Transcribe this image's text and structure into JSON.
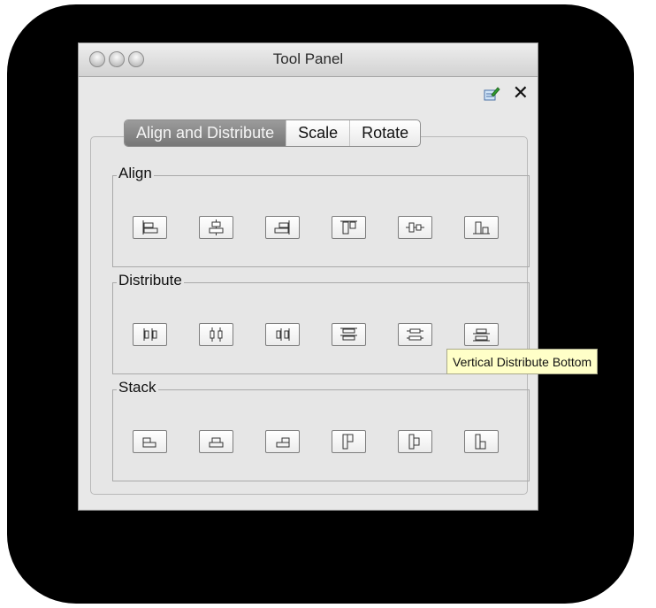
{
  "window": {
    "title": "Tool Panel"
  },
  "toolbar": {
    "edit_icon": "edit-pencil-icon",
    "close_icon": "close-icon",
    "close_glyph": "✕"
  },
  "tabs": [
    {
      "label": "Align and Distribute",
      "selected": true
    },
    {
      "label": "Scale",
      "selected": false
    },
    {
      "label": "Rotate",
      "selected": false
    }
  ],
  "sections": [
    {
      "title": "Align",
      "buttons": [
        "align-left-icon",
        "align-center-horizontal-icon",
        "align-right-icon",
        "align-top-icon",
        "align-center-vertical-icon",
        "align-bottom-icon"
      ]
    },
    {
      "title": "Distribute",
      "buttons": [
        "distribute-left-icon",
        "distribute-center-horizontal-icon",
        "distribute-right-icon",
        "distribute-top-icon",
        "distribute-center-vertical-icon",
        "distribute-bottom-icon"
      ]
    },
    {
      "title": "Stack",
      "buttons": [
        "stack-left-icon",
        "stack-center-icon",
        "stack-right-icon",
        "stack-top-icon",
        "stack-middle-icon",
        "stack-bottom-icon"
      ]
    }
  ],
  "tooltip": {
    "text": "Vertical Distribute Bottom"
  },
  "colors": {
    "tooltip_bg": "#ffffc8",
    "tab_active": "#888888",
    "backdrop": "#000000"
  }
}
